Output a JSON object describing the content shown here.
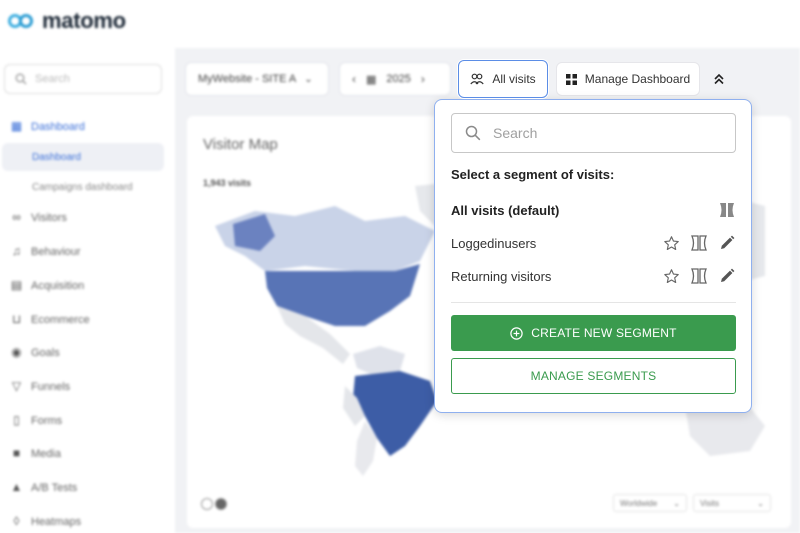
{
  "app": {
    "logo_text": "matomo",
    "brand_color": "#3daee0"
  },
  "sidebar": {
    "search_placeholder": "Search",
    "items": [
      {
        "label": "Dashboard",
        "icon": "grid-icon",
        "active": true
      },
      {
        "label": "Visitors",
        "icon": "glasses-icon"
      },
      {
        "label": "Behaviour",
        "icon": "bell-icon"
      },
      {
        "label": "Acquisition",
        "icon": "box-icon"
      },
      {
        "label": "Ecommerce",
        "icon": "cart-icon"
      },
      {
        "label": "Goals",
        "icon": "target-icon"
      },
      {
        "label": "Funnels",
        "icon": "funnel-icon"
      },
      {
        "label": "Forms",
        "icon": "clipboard-icon"
      },
      {
        "label": "Media",
        "icon": "media-icon"
      },
      {
        "label": "A/B Tests",
        "icon": "flask-icon"
      },
      {
        "label": "Heatmaps",
        "icon": "flame-icon"
      }
    ],
    "subitems": [
      {
        "label": "Dashboard",
        "selected": true
      },
      {
        "label": "Campaigns dashboard"
      }
    ]
  },
  "toolbar": {
    "site_selector": "MyWebsite - SITE A",
    "period": "2025",
    "segment_button": "All visits",
    "manage_dashboard": "Manage Dashboard"
  },
  "widget": {
    "title": "Visitor Map",
    "visits": "1,943 visits",
    "region_select": "Worldwide",
    "metric_select": "Visits"
  },
  "segment_dropdown": {
    "search_placeholder": "Search",
    "heading": "Select a segment of visits:",
    "segments": [
      {
        "name": "All visits (default)",
        "default": true
      },
      {
        "name": "Loggedinusers"
      },
      {
        "name": "Returning visitors"
      }
    ],
    "create_label": "CREATE NEW SEGMENT",
    "manage_label": "MANAGE SEGMENTS",
    "accent_color": "#3a9b4e"
  }
}
